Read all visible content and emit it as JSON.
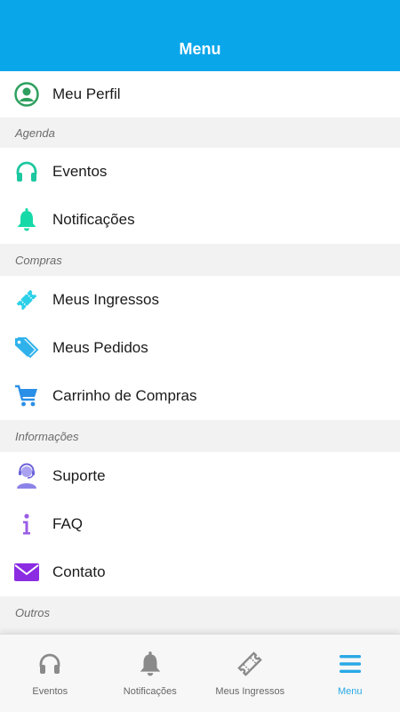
{
  "header": {
    "title": "Menu"
  },
  "profile": {
    "label": "Meu Perfil",
    "icon": "user-circle-icon",
    "color": "#2e9f5e"
  },
  "sections": {
    "agenda": "Agenda",
    "compras": "Compras",
    "informacoes": "Informações",
    "outros": "Outros"
  },
  "items": {
    "eventos": {
      "label": "Eventos",
      "icon": "headphones-icon",
      "color": "#1dc7a0"
    },
    "notificacoes": {
      "label": "Notificações",
      "icon": "bell-icon",
      "color": "#16d9a8"
    },
    "ingressos": {
      "label": "Meus Ingressos",
      "icon": "ticket-icon",
      "color": "#2bd0e8"
    },
    "pedidos": {
      "label": "Meus Pedidos",
      "icon": "tags-icon",
      "color": "#2fb2ec"
    },
    "carrinho": {
      "label": "Carrinho de Compras",
      "icon": "cart-icon",
      "color": "#2a8fe6"
    },
    "suporte": {
      "label": "Suporte",
      "icon": "support-agent-icon",
      "color": "#8c83e8"
    },
    "faq": {
      "label": "FAQ",
      "icon": "info-icon",
      "color": "#9b5de5"
    },
    "contato": {
      "label": "Contato",
      "icon": "envelope-icon",
      "color": "#8b2be2"
    }
  },
  "tabbar": {
    "tabs": [
      {
        "label": "Eventos",
        "icon": "headphones-icon"
      },
      {
        "label": "Notificações",
        "icon": "bell-icon"
      },
      {
        "label": "Meus Ingressos",
        "icon": "ticket-icon"
      },
      {
        "label": "Menu",
        "icon": "hamburger-menu-icon",
        "active": true
      }
    ],
    "inactive_color": "#8a8a8a",
    "active_color": "#2aa9e6"
  }
}
